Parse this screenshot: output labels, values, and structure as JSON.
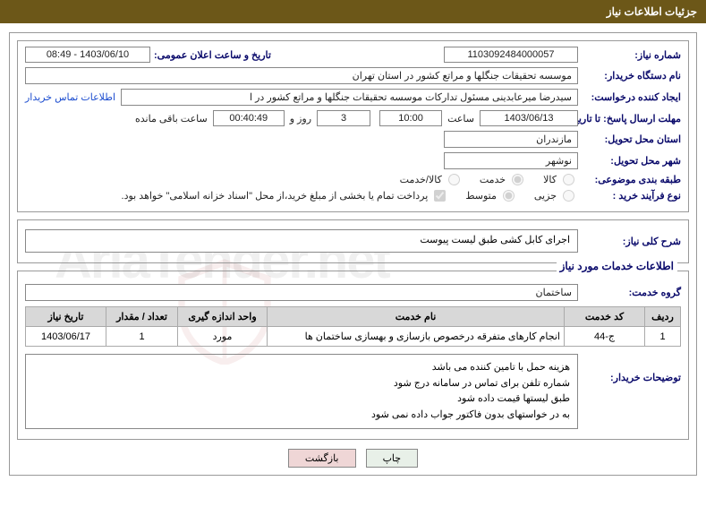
{
  "page_title": "جزئیات اطلاعات نیاز",
  "fields": {
    "need_number_label": "شماره نیاز:",
    "need_number": "1103092484000057",
    "announce_datetime_label": "تاریخ و ساعت اعلان عمومی:",
    "announce_datetime": "1403/06/10 - 08:49",
    "buyer_org_label": "نام دستگاه خریدار:",
    "buyer_org": "موسسه تحقیقات جنگلها و مراتع کشور در استان تهران",
    "requester_label": "ایجاد کننده درخواست:",
    "requester": "سیدرضا میرعابدینی مسئول تدارکات موسسه تحقیقات جنگلها و مراتع کشور در ا",
    "buyer_contact_link": "اطلاعات تماس خریدار",
    "deadline_label": "مهلت ارسال پاسخ: تا تاریخ:",
    "deadline_date": "1403/06/13",
    "time_label": "ساعت",
    "deadline_time": "10:00",
    "days_value": "3",
    "days_and": "روز و",
    "countdown": "00:40:49",
    "remaining_label": "ساعت باقی مانده",
    "delivery_province_label": "استان محل تحویل:",
    "delivery_province": "مازندران",
    "delivery_city_label": "شهر محل تحویل:",
    "delivery_city": "نوشهر",
    "category_label": "طبقه بندی موضوعی:",
    "cat_goods": "کالا",
    "cat_service": "خدمت",
    "cat_goods_service": "کالا/خدمت",
    "purchase_type_label": "نوع فرآیند خرید :",
    "pt_minor": "جزیی",
    "pt_medium": "متوسط",
    "treasury_note": "پرداخت تمام یا بخشی از مبلغ خرید،از محل \"اسناد خزانه اسلامی\" خواهد بود.",
    "need_desc_label": "شرح کلی نیاز:",
    "need_desc": "اجرای کابل کشی طبق لیست پیوست",
    "services_info_title": "اطلاعات خدمات مورد نیاز",
    "service_group_label": "گروه خدمت:",
    "service_group": "ساختمان",
    "buyer_notes_label": "توضیحات خریدار:",
    "buyer_notes_l1": "هزینه حمل با تامین کننده می باشد",
    "buyer_notes_l2": "شماره تلفن برای تماس در سامانه درج شود",
    "buyer_notes_l3": "طبق لیستها قیمت داده شود",
    "buyer_notes_l4": "به در خواستهای بدون فاکتور جواب داده نمی شود"
  },
  "table": {
    "headers": {
      "row": "ردیف",
      "service_code": "کد خدمت",
      "service_name": "نام خدمت",
      "unit": "واحد اندازه گیری",
      "qty": "تعداد / مقدار",
      "need_date": "تاریخ نیاز"
    },
    "rows": [
      {
        "row": "1",
        "service_code": "ج-44",
        "service_name": "انجام کارهای متفرقه درخصوص بازسازی و بهسازی ساختمان ها",
        "unit": "مورد",
        "qty": "1",
        "need_date": "1403/06/17"
      }
    ]
  },
  "buttons": {
    "print": "چاپ",
    "back": "بازگشت"
  },
  "watermark": "AriaTender.net"
}
